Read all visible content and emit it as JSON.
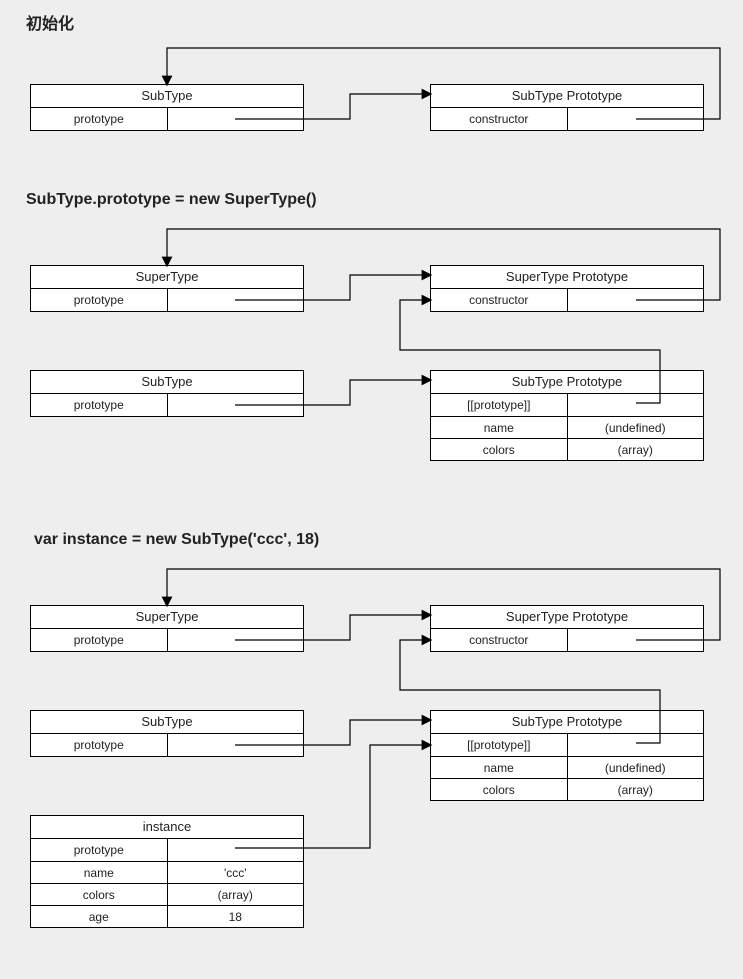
{
  "section1": {
    "title": "初始化",
    "left": {
      "title": "SubType",
      "prop": "prototype"
    },
    "right": {
      "title": "SubType Prototype",
      "prop": "constructor"
    }
  },
  "section2": {
    "title": "SubType.prototype = new SuperType()",
    "superL": {
      "title": "SuperType",
      "prop": "prototype"
    },
    "superR": {
      "title": "SuperType Prototype",
      "prop": "constructor"
    },
    "subL": {
      "title": "SubType",
      "prop": "prototype"
    },
    "subR": {
      "title": "SubType Prototype",
      "rows": [
        {
          "key": "[[prototype]]",
          "val": ""
        },
        {
          "key": "name",
          "val": "(undefined)"
        },
        {
          "key": "colors",
          "val": "(array)"
        }
      ]
    }
  },
  "section3": {
    "title": "var instance = new SubType('ccc', 18)",
    "superL": {
      "title": "SuperType",
      "prop": "prototype"
    },
    "superR": {
      "title": "SuperType Prototype",
      "prop": "constructor"
    },
    "subL": {
      "title": "SubType",
      "prop": "prototype"
    },
    "subR": {
      "title": "SubType Prototype",
      "rows": [
        {
          "key": "[[prototype]]",
          "val": ""
        },
        {
          "key": "name",
          "val": "(undefined)"
        },
        {
          "key": "colors",
          "val": "(array)"
        }
      ]
    },
    "inst": {
      "title": "instance",
      "rows": [
        {
          "key": "prototype",
          "val": ""
        },
        {
          "key": "name",
          "val": "'ccc'"
        },
        {
          "key": "colors",
          "val": "(array)"
        },
        {
          "key": "age",
          "val": "18"
        }
      ]
    }
  }
}
